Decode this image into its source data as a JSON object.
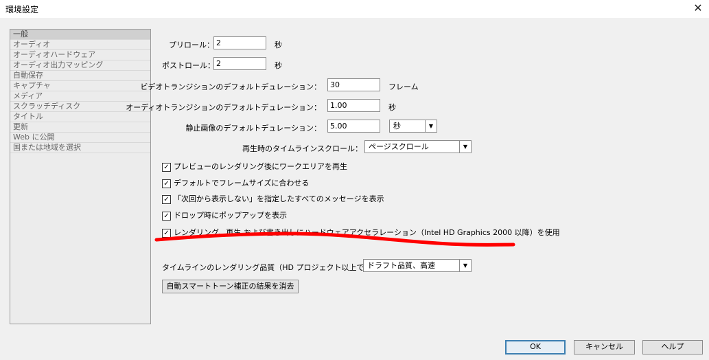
{
  "window": {
    "title": "環境設定",
    "close_glyph": "✕"
  },
  "sidebar": {
    "items": [
      {
        "label": "一般"
      },
      {
        "label": "オーディオ"
      },
      {
        "label": "オーディオハードウェア"
      },
      {
        "label": "オーディオ出力マッピング"
      },
      {
        "label": "自動保存"
      },
      {
        "label": "キャプチャ"
      },
      {
        "label": "メディア"
      },
      {
        "label": "スクラッチディスク"
      },
      {
        "label": "タイトル"
      },
      {
        "label": "更新"
      },
      {
        "label": "Web に公開"
      },
      {
        "label": "国または地域を選択"
      }
    ]
  },
  "general": {
    "preroll": {
      "label": "プリロール：",
      "value": "2",
      "unit": "秒"
    },
    "postroll": {
      "label": "ポストロール：",
      "value": "2",
      "unit": "秒"
    },
    "video_transition": {
      "label": "ビデオトランジションのデフォルトデュレーション：",
      "value": "30",
      "unit": "フレーム"
    },
    "audio_transition": {
      "label": "オーディオトランジションのデフォルトデュレーション：",
      "value": "1.00",
      "unit": "秒"
    },
    "still_image": {
      "label": "静止画像のデフォルトデュレーション：",
      "value": "5.00",
      "unit_select": "秒"
    },
    "timeline_scroll": {
      "label": "再生時のタイムラインスクロール：",
      "selected": "ページスクロール"
    },
    "checkboxes": [
      {
        "label": "プレビューのレンダリング後にワークエリアを再生",
        "checked": true
      },
      {
        "label": "デフォルトでフレームサイズに合わせる",
        "checked": true
      },
      {
        "label": "「次回から表示しない」を指定したすべてのメッセージを表示",
        "checked": true
      },
      {
        "label": "ドロップ時にポップアップを表示",
        "checked": true
      },
      {
        "label": "レンダリング、再生 および書き出しにハードウェアアクセラレーション（Intel HD Graphics 2000 以降）を使用",
        "checked": true
      }
    ],
    "render_quality": {
      "label": "タイムラインのレンダリング品質（HD プロジェクト以上で有効）：",
      "selected": "ドラフト品質、高速"
    },
    "clear_button": "自動スマートトーン補正の結果を消去"
  },
  "buttons": {
    "ok": "OK",
    "cancel": "キャンセル",
    "help": "ヘルプ"
  },
  "check_glyph": "✓",
  "dropdown_glyph": "▼",
  "annotation_color": "#ff0000"
}
